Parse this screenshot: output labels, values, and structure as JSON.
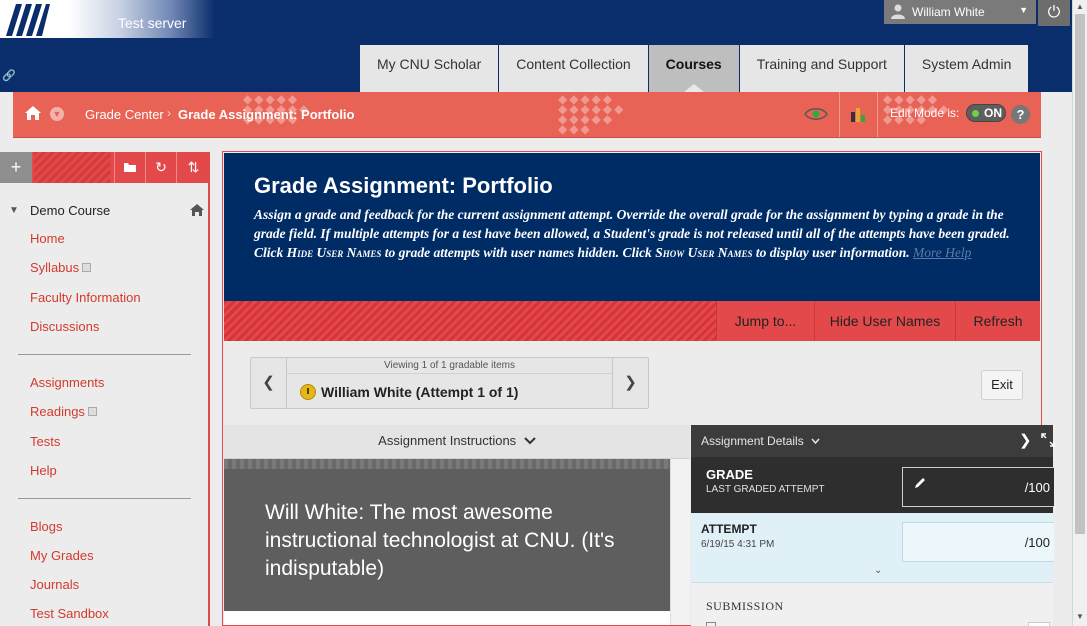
{
  "header": {
    "server_label": "Test server",
    "user_name": "William White"
  },
  "tabs": [
    {
      "label": "My CNU Scholar"
    },
    {
      "label": "Content Collection"
    },
    {
      "label": "Courses"
    },
    {
      "label": "Training and Support"
    },
    {
      "label": "System Admin"
    }
  ],
  "breadcrumb": {
    "items": [
      "Grade Center",
      "Grade Assignment: Portfolio"
    ],
    "separator": "›"
  },
  "edit_mode": {
    "label": "Edit Mode is:",
    "state": "ON",
    "help": "?"
  },
  "course_menu": {
    "course_name": "Demo Course",
    "group1": [
      "Home",
      "Syllabus",
      "Faculty Information",
      "Discussions"
    ],
    "group2": [
      "Assignments",
      "Readings",
      "Tests",
      "Help"
    ],
    "group3": [
      "Blogs",
      "My Grades",
      "Journals",
      "Test Sandbox"
    ]
  },
  "page": {
    "title": "Grade Assignment: Portfolio",
    "desc_1": "Assign a grade and feedback for the current assignment attempt. Override the overall grade for the assignment by typing a grade in the grade field. If multiple attempts for a test have been allowed, a Student's grade is not released until all of the attempts have been graded. Click ",
    "desc_hide": "Hide User Names",
    "desc_2": " to grade attempts with user names hidden. Click ",
    "desc_show": "Show User Names",
    "desc_3": " to display user information. ",
    "more_help": "More Help"
  },
  "actions": {
    "jump_to": "Jump to...",
    "hide_user_names": "Hide User Names",
    "refresh": "Refresh"
  },
  "navigator": {
    "caption": "Viewing 1 of 1 gradable items",
    "student": "William White (Attempt 1 of 1)",
    "exit": "Exit"
  },
  "instructions": {
    "header": "Assignment Instructions",
    "text": "Will White: The most awesome instructional technologist at CNU. (It's indisputable)"
  },
  "details": {
    "header": "Assignment Details",
    "grade_label": "GRADE",
    "grade_sub": "LAST GRADED ATTEMPT",
    "grade_value": "/100",
    "attempt_label": "ATTEMPT",
    "attempt_date": "6/19/15 4:31 PM",
    "attempt_value": "/100",
    "submission_label": "SUBMISSION"
  },
  "colors": {
    "navy": "#0a2d6b",
    "accent_red": "#e3494a",
    "breadcrumb_red": "#e86356",
    "link_red": "#d33a2c",
    "toggle_on": "#6ad24a"
  }
}
